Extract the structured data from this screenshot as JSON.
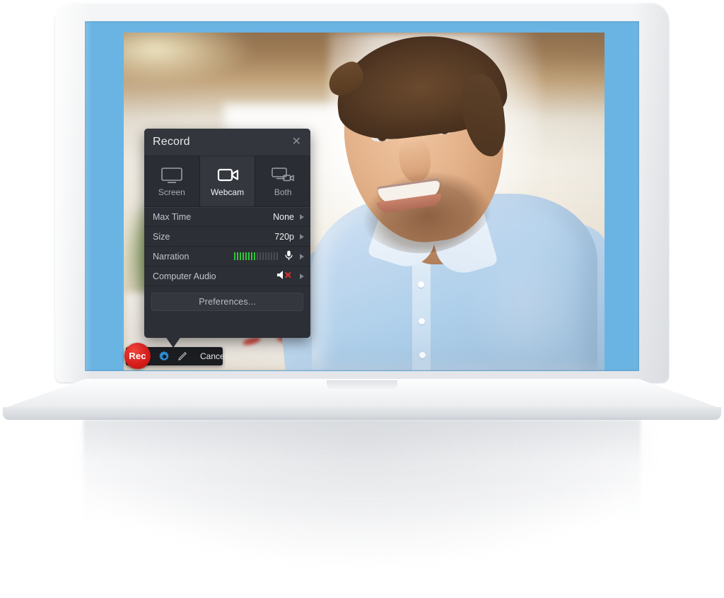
{
  "app": {
    "desktop_bg_color": "#6ab4e4",
    "photo_description": "smiling-man-blue-shirt-office"
  },
  "record_panel": {
    "title": "Record",
    "close_icon": "close-icon",
    "tabs": [
      {
        "label": "Screen",
        "icon": "monitor-icon",
        "active": false
      },
      {
        "label": "Webcam",
        "icon": "video-camera-icon",
        "active": true
      },
      {
        "label": "Both",
        "icon": "monitor-plus-camera-icon",
        "active": false
      }
    ],
    "rows": [
      {
        "label": "Max Time",
        "value": "None",
        "kind": "value",
        "chevron": "chevron-right-icon"
      },
      {
        "label": "Size",
        "value": "720p",
        "kind": "value",
        "chevron": "chevron-right-icon"
      },
      {
        "label": "Narration",
        "value": "",
        "kind": "meter",
        "icon": "microphone-icon",
        "meter_segments": 16,
        "meter_lit": 8,
        "meter_color": "#34c53a",
        "chevron": "chevron-right-icon"
      },
      {
        "label": "Computer Audio",
        "value": "",
        "kind": "muted",
        "icon": "speaker-muted-icon",
        "mute_mark_color": "#d9332c",
        "chevron": "chevron-right-icon"
      }
    ],
    "preferences_label": "Preferences..."
  },
  "toolbar": {
    "record_label": "Rec",
    "record_color": "#d81f1c",
    "gear_icon": "gear-icon",
    "gear_color": "#2f8fd6",
    "pencil_icon": "pencil-icon",
    "cancel_label": "Cancel"
  }
}
